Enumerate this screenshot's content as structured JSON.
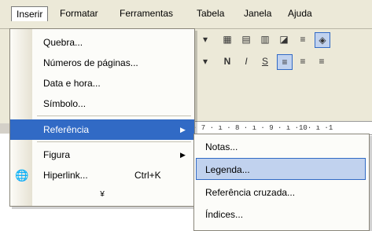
{
  "menubar": {
    "items": [
      {
        "label": "Inserir"
      },
      {
        "label": "Formatar"
      },
      {
        "label": "Ferramentas"
      },
      {
        "label": "Tabela"
      },
      {
        "label": "Janela"
      },
      {
        "label": "Ajuda"
      }
    ]
  },
  "insert_menu": {
    "items": [
      {
        "label": "Quebra..."
      },
      {
        "label": "Números de páginas..."
      },
      {
        "label": "Data e hora..."
      },
      {
        "label": "Símbolo..."
      },
      {
        "label": "Referência",
        "has_submenu": true
      },
      {
        "label": "Figura",
        "has_submenu": true
      },
      {
        "label": "Hiperlink...",
        "shortcut": "Ctrl+K",
        "icon": "hyperlink-icon"
      }
    ],
    "expand_glyph": "¥"
  },
  "reference_submenu": {
    "items": [
      {
        "label": "Notas..."
      },
      {
        "label": "Legenda..."
      },
      {
        "label": "Referência cruzada..."
      },
      {
        "label": "Índices..."
      }
    ]
  },
  "toolbar": {
    "bold": "N",
    "italic": "I",
    "underline": "S"
  },
  "ruler": {
    "text": "· 7 · ı · 8 · ı · 9 · ı ·10· ı ·1"
  },
  "colors": {
    "highlight": "#316ac5",
    "highlight_light": "#c1d2ee",
    "menu_bg": "#fcfcf9"
  }
}
